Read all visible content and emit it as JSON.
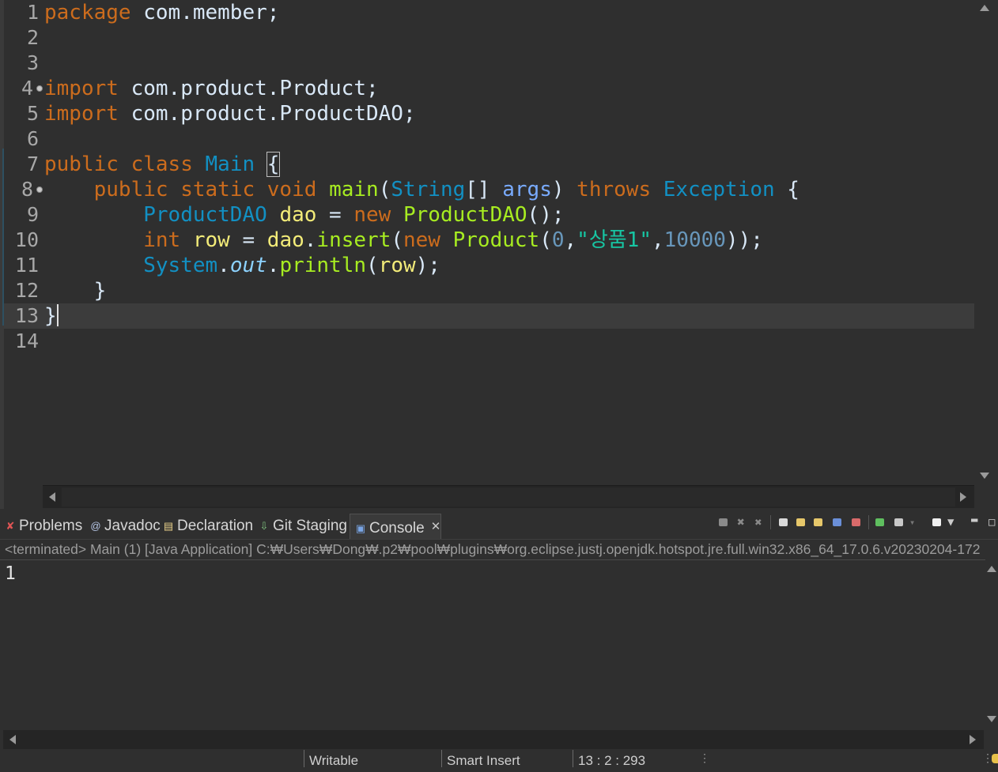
{
  "editor": {
    "lines": [
      {
        "num": "1"
      },
      {
        "num": "2"
      },
      {
        "num": "3"
      },
      {
        "num": "4"
      },
      {
        "num": "5"
      },
      {
        "num": "6"
      },
      {
        "num": "7"
      },
      {
        "num": "8"
      },
      {
        "num": "9"
      },
      {
        "num": "10"
      },
      {
        "num": "11"
      },
      {
        "num": "12"
      },
      {
        "num": "13"
      },
      {
        "num": "14"
      }
    ],
    "tokens": {
      "package": "package",
      "pkg_name": "com.member;",
      "import": "import",
      "import1": "com.product.Product;",
      "import2": "com.product.ProductDAO;",
      "public": "public",
      "class": "class",
      "main_class": "Main",
      "open_brace": "{",
      "static": "static",
      "void": "void",
      "main_method": "main",
      "string_type": "String",
      "array_brackets": "[]",
      "args": "args",
      "throws": "throws",
      "exception": "Exception",
      "productdao_type": "ProductDAO",
      "dao": "dao",
      "assign": " = ",
      "new": "new",
      "productdao_ctor": "ProductDAO",
      "ctor_end": "();",
      "int": "int",
      "row": "row",
      "dao_ref": "dao",
      "dot": ".",
      "insert": "insert",
      "paren_open": "(",
      "product_ctor": "Product",
      "zero": "0",
      "comma": ",",
      "str_value": "\"상품1\"",
      "price": "10000",
      "close_parens": "));",
      "system": "System",
      "out": "out",
      "println": "println",
      "row_arg": "row",
      "close_paren_semi": ");",
      "close_brace": "}"
    }
  },
  "console": {
    "tabs": [
      {
        "label": "Problems",
        "icon": "problems-icon"
      },
      {
        "label": "Javadoc",
        "icon": "javadoc-icon"
      },
      {
        "label": "Declaration",
        "icon": "declaration-icon"
      },
      {
        "label": "Git Staging",
        "icon": "git-staging-icon"
      },
      {
        "label": "Console",
        "icon": "console-icon"
      }
    ],
    "description": "<terminated> Main (1) [Java Application] C:₩Users₩Dong₩.p2₩pool₩plugins₩org.eclipse.justj.openjdk.hotspot.jre.full.win32.x86_64_17.0.6.v20230204-172",
    "output": "1"
  },
  "status": {
    "writable": "Writable",
    "insert_mode": "Smart Insert",
    "position": "13 : 2 : 293"
  },
  "colors": {
    "background": "#2f2f2f",
    "keyword": "#cc6c1d",
    "class": "#1290c3",
    "variable": "#f3ec79",
    "method": "#a7ec21",
    "string": "#17c6a3",
    "number": "#6897bb"
  }
}
